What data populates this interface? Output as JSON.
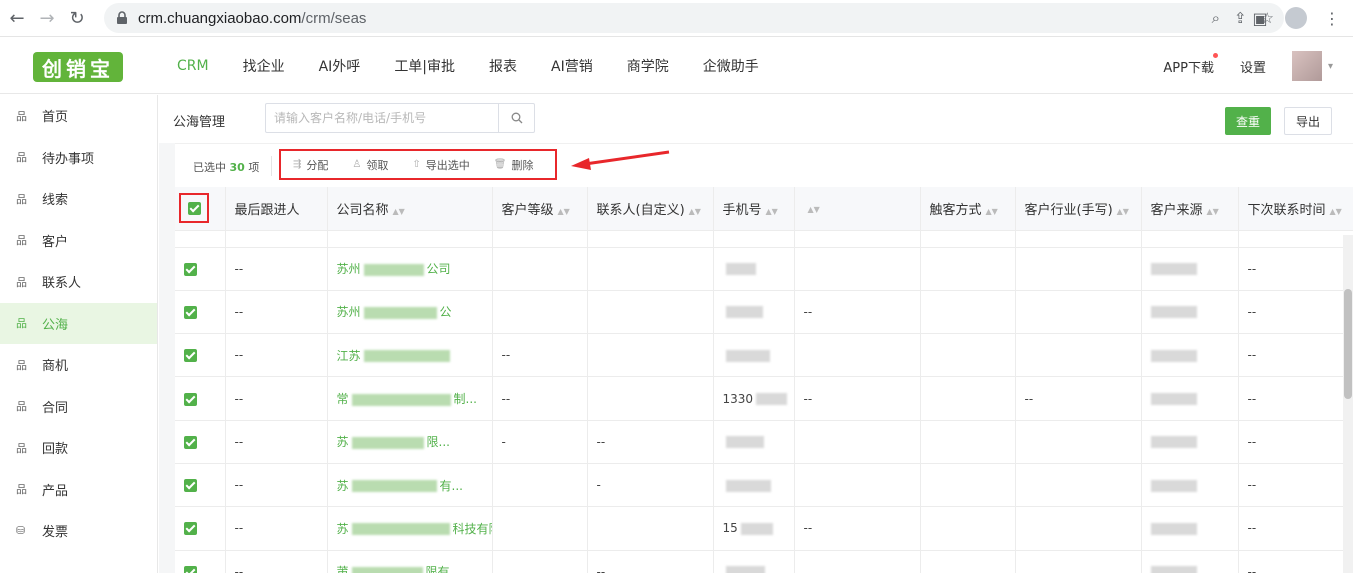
{
  "browser": {
    "url_host": "crm.chuangxiaobao.com",
    "url_path": "/crm/seas"
  },
  "header": {
    "logo_text": "创销宝",
    "nav": [
      {
        "label": "CRM",
        "active": true
      },
      {
        "label": "找企业"
      },
      {
        "label": "AI外呼"
      },
      {
        "label": "工单|审批"
      },
      {
        "label": "报表"
      },
      {
        "label": "AI营销"
      },
      {
        "label": "商学院"
      },
      {
        "label": "企微助手"
      }
    ],
    "app_download": "APP下载",
    "settings": "设置"
  },
  "sidebar": {
    "items": [
      {
        "label": "首页"
      },
      {
        "label": "待办事项"
      },
      {
        "label": "线索"
      },
      {
        "label": "客户"
      },
      {
        "label": "联系人"
      },
      {
        "label": "公海",
        "active": true
      },
      {
        "label": "商机"
      },
      {
        "label": "合同"
      },
      {
        "label": "回款"
      },
      {
        "label": "产品"
      },
      {
        "label": "发票"
      }
    ]
  },
  "toolbar": {
    "page_label": "公海管理",
    "search_placeholder": "请输入客户名称/电话/手机号",
    "reset_label": "查重",
    "export_label": "导出"
  },
  "selection": {
    "prefix": "已选中",
    "count": "30",
    "suffix": "项",
    "actions": [
      "分配",
      "领取",
      "导出选中",
      "删除"
    ]
  },
  "table": {
    "columns": [
      "最后跟进人",
      "公司名称",
      "客户等级",
      "联系人(自定义)",
      "手机号",
      "",
      "触客方式",
      "客户行业(手写)",
      "客户来源",
      "下次联系时间"
    ],
    "rows": [
      {
        "follow": "--",
        "company_pre": "苏州",
        "company_post": "公司",
        "level": "",
        "contact": "",
        "phone": "",
        "c6": "",
        "industry": "",
        "next": "--"
      },
      {
        "follow": "--",
        "company_pre": "苏州",
        "company_post": "公",
        "level": "",
        "contact": "",
        "phone": "",
        "c6": "--",
        "industry": "",
        "next": "--"
      },
      {
        "follow": "--",
        "company_pre": "江苏",
        "company_post": "",
        "level": "--",
        "contact": "",
        "phone": "",
        "c6": "",
        "industry": "",
        "next": "--"
      },
      {
        "follow": "--",
        "company_pre": "常",
        "company_post": "制...",
        "level": "--",
        "contact": "",
        "phone": "1330",
        "c6": "--",
        "industry": "--",
        "next": "--"
      },
      {
        "follow": "--",
        "company_pre": "苏",
        "company_post": "限...",
        "level": "-",
        "contact": "--",
        "phone": "",
        "c6": "",
        "industry": "",
        "next": "--"
      },
      {
        "follow": "--",
        "company_pre": "苏",
        "company_post": "有...",
        "level": "",
        "contact": "-",
        "phone": "",
        "c6": "",
        "industry": "",
        "next": "--"
      },
      {
        "follow": "--",
        "company_pre": "苏",
        "company_post": "科技有限公司",
        "level": "",
        "contact": "",
        "phone": "15",
        "c6": "--",
        "industry": "",
        "next": "--"
      },
      {
        "follow": "--",
        "company_pre": "莆",
        "company_post": "限有",
        "level": "",
        "contact": "--",
        "phone": "",
        "c6": "",
        "industry": "",
        "next": "--"
      }
    ]
  }
}
